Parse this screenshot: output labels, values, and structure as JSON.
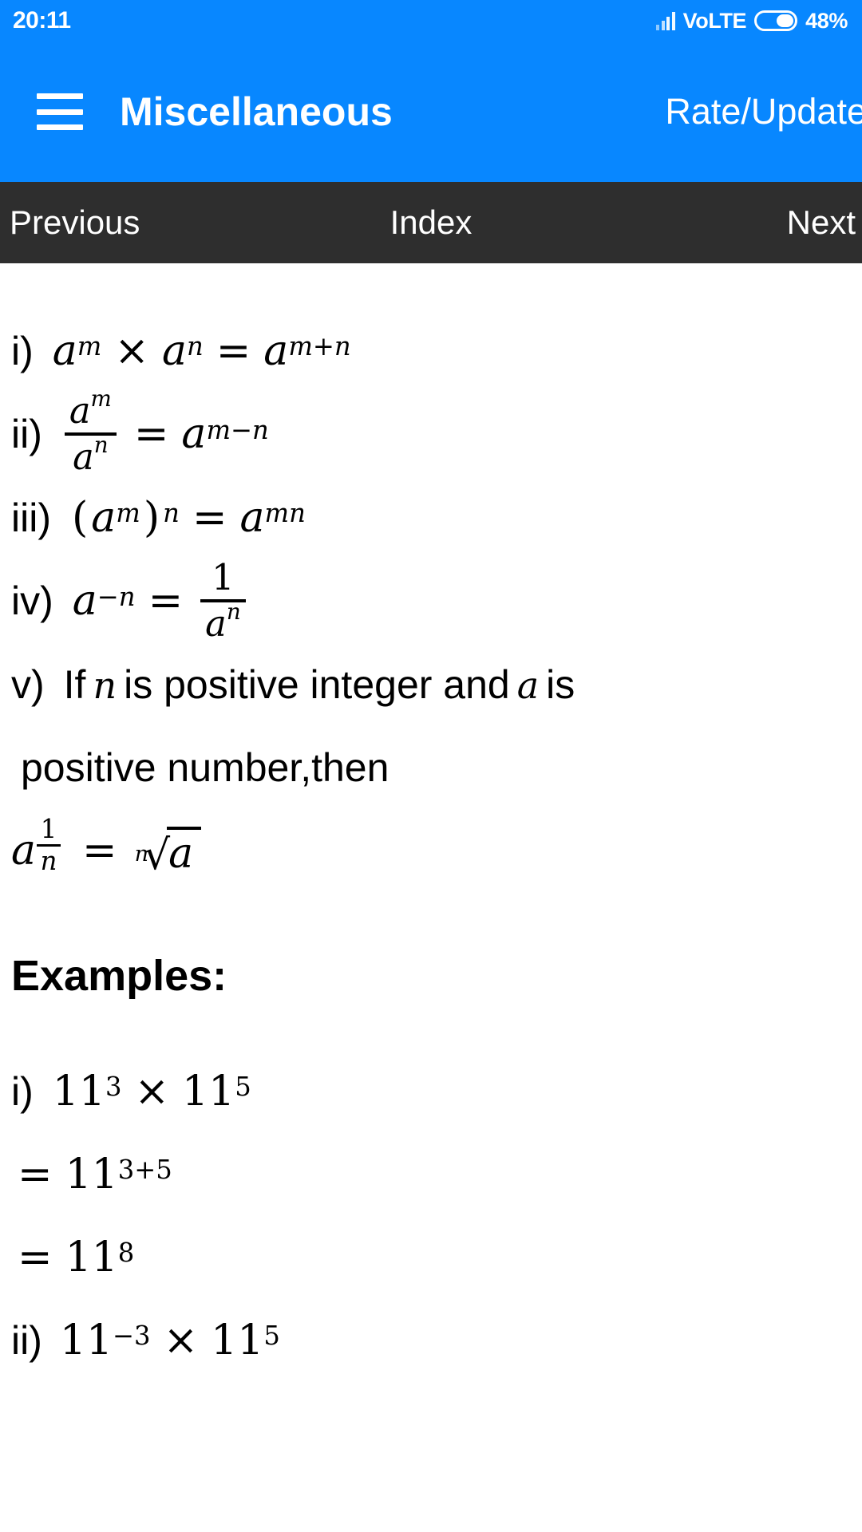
{
  "theme": {
    "accent": "#0887FF",
    "nav_bar_bg": "#2e2e2e",
    "page_bg": "#ffffff",
    "text": "#000000",
    "on_accent": "#ffffff"
  },
  "status_bar": {
    "clock": "20:11",
    "network_label": "VoLTE",
    "battery_percent": "48%",
    "battery_level": 48,
    "signal_icon": "signal-bars-icon",
    "battery_icon": "battery-icon"
  },
  "app_bar": {
    "menu_icon": "hamburger-menu-icon",
    "title": "Miscellaneous",
    "action_label": "Rate/Update"
  },
  "nav_bar": {
    "previous_label": "Previous",
    "index_label": "Index",
    "next_label": "Next"
  },
  "content": {
    "rules": [
      {
        "marker": "i)",
        "type": "formula",
        "latex": "a^m \\times a^n = a^{m+n}",
        "parts": {
          "base1": "a",
          "exp1": "m",
          "operator": "×",
          "base2": "a",
          "exp2": "n",
          "equals": "=",
          "base3": "a",
          "exp3": "m+n"
        }
      },
      {
        "marker": "ii)",
        "type": "fraction-formula",
        "latex": "\\frac{a^m}{a^n} = a^{m-n}",
        "parts": {
          "numerator_base": "a",
          "numerator_exp": "m",
          "denominator_base": "a",
          "denominator_exp": "n",
          "equals": "=",
          "result_base": "a",
          "result_exp": "m−n"
        }
      },
      {
        "marker": "iii)",
        "type": "formula",
        "latex": "(a^m)^n = a^{mn}",
        "parts": {
          "open_paren": "(",
          "base": "a",
          "inner_exp": "m",
          "close_paren": ")",
          "outer_exp": "n",
          "equals": "=",
          "result_base": "a",
          "result_exp": "mn"
        }
      },
      {
        "marker": "iv)",
        "type": "formula-fraction-result",
        "latex": "a^{-n} = \\frac{1}{a^n}",
        "parts": {
          "base": "a",
          "exp": "−n",
          "equals": "=",
          "numerator": "1",
          "denominator_base": "a",
          "denominator_exp": "n"
        }
      },
      {
        "marker": "v)",
        "type": "statement",
        "text_line_1_a": "If",
        "text_line_1_var1": "n",
        "text_line_1_b": "is positive integer and",
        "text_line_1_var2": "a",
        "text_line_1_c": "is",
        "text_line_2": "positive number,then",
        "formula_latex": "a^{\\frac{1}{n}} = \\sqrt[n]{a}",
        "formula_parts": {
          "base": "a",
          "exp_numerator": "1",
          "exp_denominator": "n",
          "equals": "=",
          "root_index": "n",
          "radical_sign": "√",
          "radicand": "a"
        }
      }
    ],
    "examples_heading": "Examples:",
    "examples": [
      {
        "marker": "i)",
        "latex": "11^3 \\times 11^5",
        "parts": {
          "base1": "11",
          "exp1": "3",
          "operator": "×",
          "base2": "11",
          "exp2": "5"
        }
      },
      {
        "marker": "",
        "latex": "= 11^{3+5}",
        "parts": {
          "equals": "=",
          "base": "11",
          "exp": "3+5"
        }
      },
      {
        "marker": "",
        "latex": "= 11^8",
        "parts": {
          "equals": "=",
          "base": "11",
          "exp": "8"
        }
      },
      {
        "marker": "ii)",
        "latex": "11^{-3} \\times 11^5",
        "parts": {
          "base1": "11",
          "exp1": "−3",
          "operator": "×",
          "base2": "11",
          "exp2": "5"
        }
      }
    ]
  }
}
